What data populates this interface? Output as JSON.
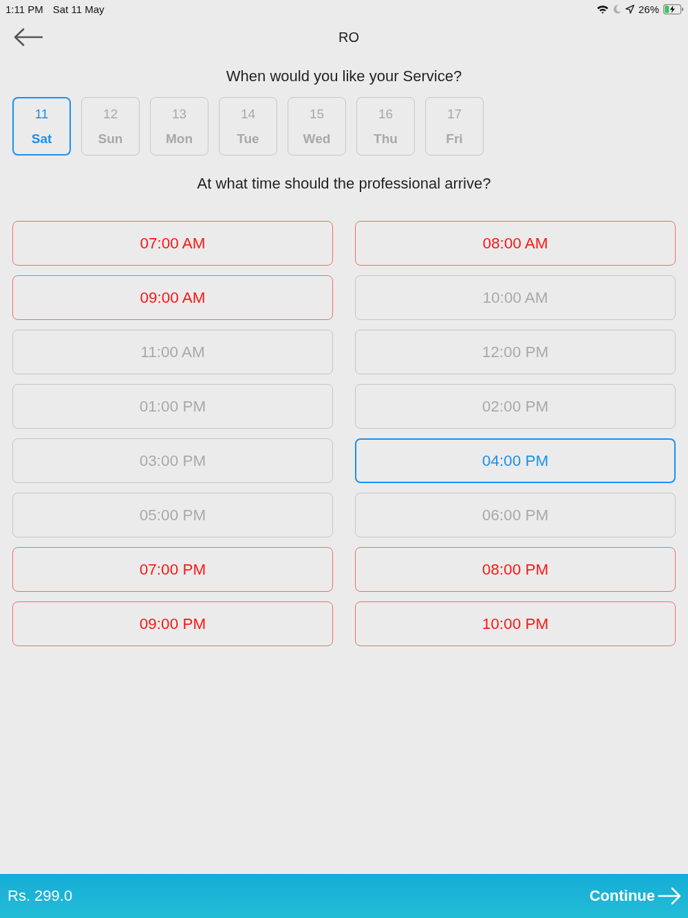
{
  "status_bar": {
    "time": "1:11 PM",
    "date": "Sat 11 May",
    "battery": "26%"
  },
  "header": {
    "title": "RO"
  },
  "date_picker": {
    "prompt": "When would you like your Service?",
    "dates": [
      {
        "day_number": "11",
        "weekday": "Sat",
        "selected": true
      },
      {
        "day_number": "12",
        "weekday": "Sun",
        "selected": false
      },
      {
        "day_number": "13",
        "weekday": "Mon",
        "selected": false
      },
      {
        "day_number": "14",
        "weekday": "Tue",
        "selected": false
      },
      {
        "day_number": "15",
        "weekday": "Wed",
        "selected": false
      },
      {
        "day_number": "16",
        "weekday": "Thu",
        "selected": false
      },
      {
        "day_number": "17",
        "weekday": "Fri",
        "selected": false
      }
    ]
  },
  "time_picker": {
    "prompt": "At what time should the professional arrive?",
    "slots": [
      {
        "time": "07:00 AM",
        "unavailable": true,
        "selected": false
      },
      {
        "time": "08:00 AM",
        "unavailable": true,
        "selected": false
      },
      {
        "time": "09:00 AM",
        "unavailable": true,
        "selected": false
      },
      {
        "time": "10:00 AM",
        "unavailable": false,
        "selected": false
      },
      {
        "time": "11:00 AM",
        "unavailable": false,
        "selected": false
      },
      {
        "time": "12:00 PM",
        "unavailable": false,
        "selected": false
      },
      {
        "time": "01:00 PM",
        "unavailable": false,
        "selected": false
      },
      {
        "time": "02:00 PM",
        "unavailable": false,
        "selected": false
      },
      {
        "time": "03:00 PM",
        "unavailable": false,
        "selected": false
      },
      {
        "time": "04:00 PM",
        "unavailable": false,
        "selected": true
      },
      {
        "time": "05:00 PM",
        "unavailable": false,
        "selected": false
      },
      {
        "time": "06:00 PM",
        "unavailable": false,
        "selected": false
      },
      {
        "time": "07:00 PM",
        "unavailable": true,
        "selected": false
      },
      {
        "time": "08:00 PM",
        "unavailable": true,
        "selected": false
      },
      {
        "time": "09:00 PM",
        "unavailable": true,
        "selected": false
      },
      {
        "time": "10:00 PM",
        "unavailable": true,
        "selected": false
      }
    ]
  },
  "footer": {
    "price": "Rs. 299.0",
    "continue": "Continue"
  }
}
